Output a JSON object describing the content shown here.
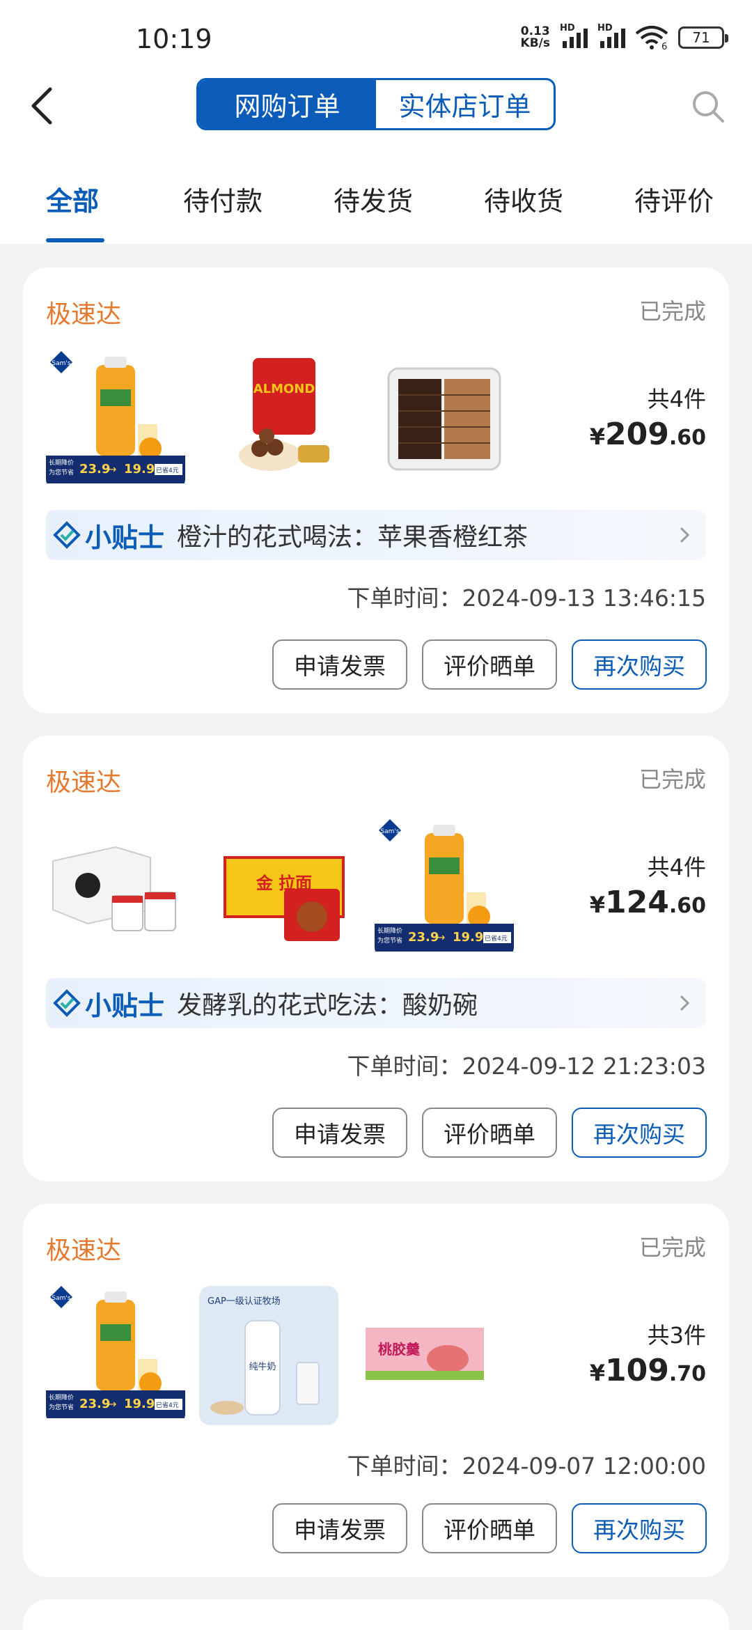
{
  "status_bar": {
    "time": "10:19",
    "net_speed_value": "0.13",
    "net_speed_unit": "KB/s",
    "hd1": "HD",
    "hd2": "HD",
    "battery": "71",
    "wifi_badge": "6"
  },
  "header": {
    "seg_online": "网购订单",
    "seg_store": "实体店订单"
  },
  "tabs": [
    "全部",
    "待付款",
    "待发货",
    "待收货",
    "待评价"
  ],
  "brand_sams": "Sam's",
  "product_texts": {
    "almond": "ALMOND",
    "promo_line1": "长期降价",
    "promo_line2": "为您节省",
    "promo_old": "23.9",
    "promo_new": "19.9",
    "promo_save": "已省4元",
    "noodle": "金 拉面",
    "gap": "GAP一级认证牧场",
    "milk": "纯牛奶",
    "peach": "桃胶羹"
  },
  "orders": [
    {
      "shop": "极速达",
      "status": "已完成",
      "qty": "共4件",
      "price_cur": "¥",
      "price_int": "209",
      "price_dec": ".60",
      "tip_label": "小贴士",
      "tip_text": "橙汁的花式喝法：苹果香橙红茶",
      "order_time": "下单时间：2024-09-13 13:46:15",
      "buttons": [
        "申请发票",
        "评价晒单",
        "再次购买"
      ]
    },
    {
      "shop": "极速达",
      "status": "已完成",
      "qty": "共4件",
      "price_cur": "¥",
      "price_int": "124",
      "price_dec": ".60",
      "tip_label": "小贴士",
      "tip_text": "发酵乳的花式吃法：酸奶碗",
      "order_time": "下单时间：2024-09-12 21:23:03",
      "buttons": [
        "申请发票",
        "评价晒单",
        "再次购买"
      ]
    },
    {
      "shop": "极速达",
      "status": "已完成",
      "qty": "共3件",
      "price_cur": "¥",
      "price_int": "109",
      "price_dec": ".70",
      "order_time": "下单时间：2024-09-07 12:00:00",
      "buttons": [
        "申请发票",
        "评价晒单",
        "再次购买"
      ]
    }
  ],
  "colors": {
    "brand_blue": "#0a5cb8",
    "shop_orange": "#e6792e"
  }
}
